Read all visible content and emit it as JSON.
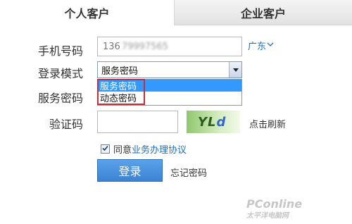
{
  "tabs": {
    "personal": "个人客户",
    "enterprise": "企业客户"
  },
  "form": {
    "phone_label": "手机号码",
    "phone_prefix": "136",
    "phone_obscured": "79997565",
    "region": "广东",
    "mode_label": "登录模式",
    "mode_selected": "服务密码",
    "mode_options": [
      "服务密码",
      "动态密码"
    ],
    "password_label": "服务密码",
    "captcha_label": "验证码",
    "captcha_text_a": "YL",
    "captcha_text_b": "d",
    "refresh_label": "点击刷新",
    "agree_prefix": "同意",
    "agree_link": "业务办理协议",
    "login_button": "登录",
    "forgot_link": "忘记密码"
  },
  "watermark": {
    "brand": "PConline",
    "sub": "太平洋电脑网"
  },
  "icons": {
    "chevron": "chevron-down-icon",
    "select_arrow": "dropdown-arrow-icon",
    "check": "checkmark-icon"
  },
  "colors": {
    "link": "#1a6fc4",
    "login_button": "#3b82d4",
    "option_highlight": "#3399ff",
    "annotation_box": "#c0303a"
  }
}
